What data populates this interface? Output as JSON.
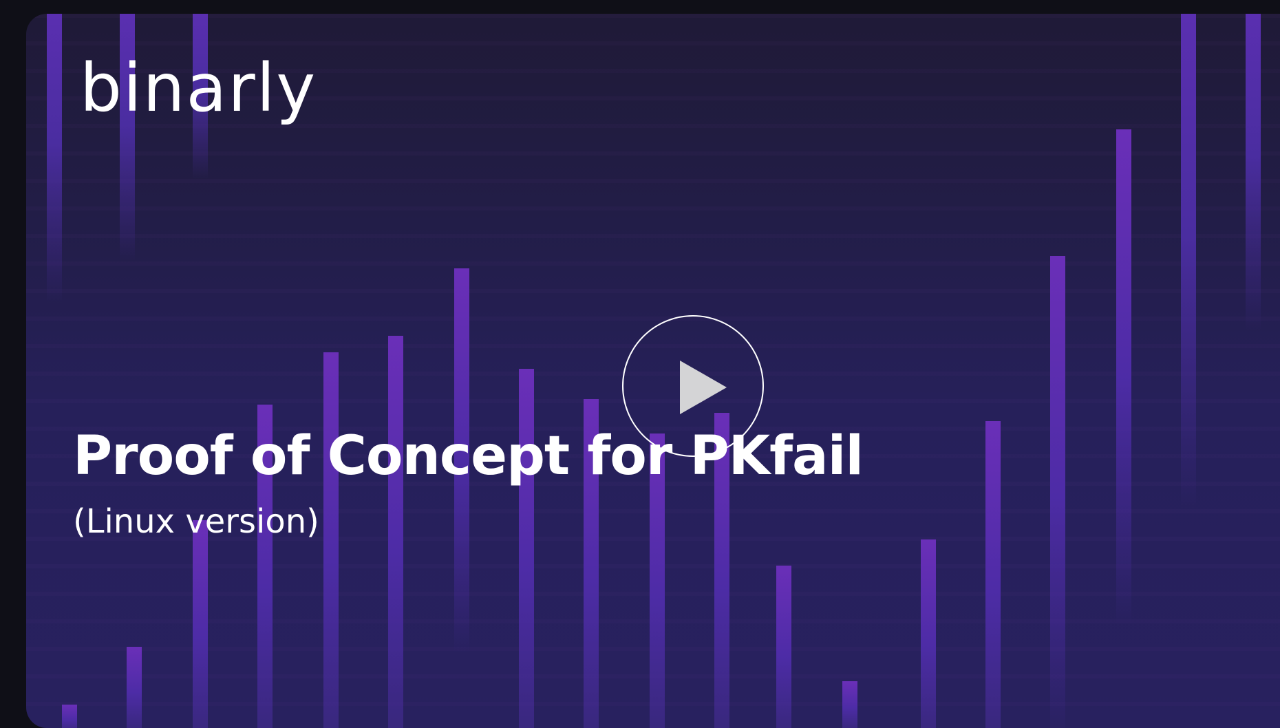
{
  "video": {
    "logo_text": "binarly",
    "title": "Proof of Concept for PKfail",
    "subtitle": "(Linux version)",
    "play_icon": "play-icon",
    "colors": {
      "background": "#0f0f17",
      "card": "#26205a",
      "bar": "#6a2fb8",
      "text": "#ffffff"
    }
  }
}
